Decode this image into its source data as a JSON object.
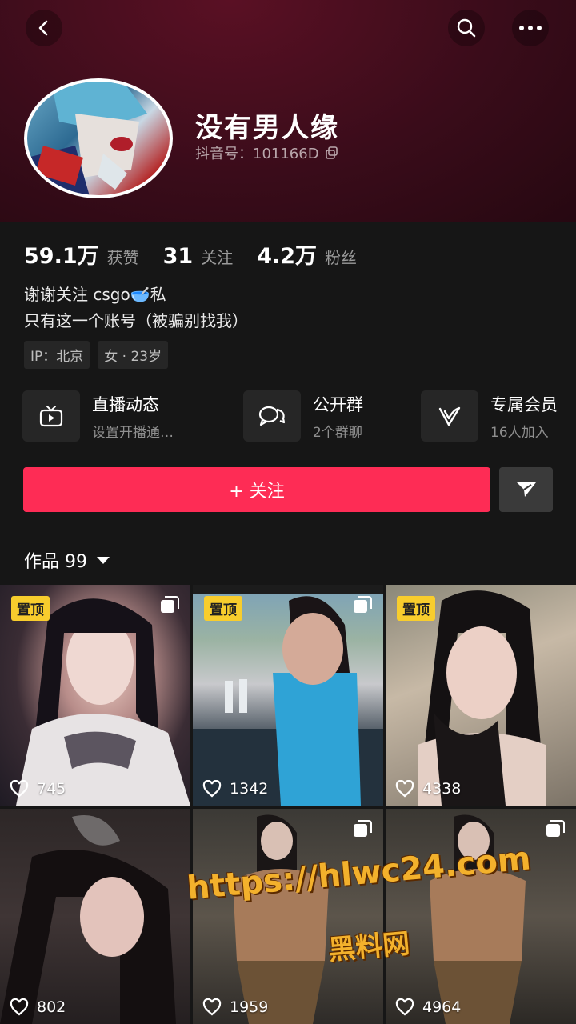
{
  "profile": {
    "name": "没有男人缘",
    "douyin_id": "抖音号：101166D"
  },
  "stats": [
    {
      "num": "59.1万",
      "label": "获赞"
    },
    {
      "num": "31",
      "label": "关注"
    },
    {
      "num": "4.2万",
      "label": "粉丝"
    }
  ],
  "bio": {
    "line1": "谢谢关注 csgo🥣私",
    "line2": "只有这一个账号（被骗别找我）"
  },
  "tags": [
    "IP：北京",
    "女 · 23岁"
  ],
  "features": [
    {
      "icon": "live-tv-icon",
      "title": "直播动态",
      "sub": "设置开播通…"
    },
    {
      "icon": "group-chat-icon",
      "title": "公开群",
      "sub": "2个群聊"
    },
    {
      "icon": "member-v-icon",
      "title": "专属会员",
      "sub": "16人加入"
    }
  ],
  "actions": {
    "follow_label": "+ 关注"
  },
  "works": {
    "label": "作品 99"
  },
  "videos": [
    {
      "pinned": "置顶",
      "likes": "745"
    },
    {
      "pinned": "置顶",
      "likes": "1342"
    },
    {
      "pinned": "置顶",
      "likes": "4338"
    },
    {
      "pinned": "",
      "likes": "802"
    },
    {
      "pinned": "",
      "likes": "1959"
    },
    {
      "pinned": "",
      "likes": "4964"
    }
  ],
  "watermark": {
    "url": "https://hlwc24.com",
    "name": "黑料网"
  },
  "colors": {
    "accent": "#fe2c55",
    "pin": "#f8cd2d",
    "header": "#3a0c1a"
  }
}
